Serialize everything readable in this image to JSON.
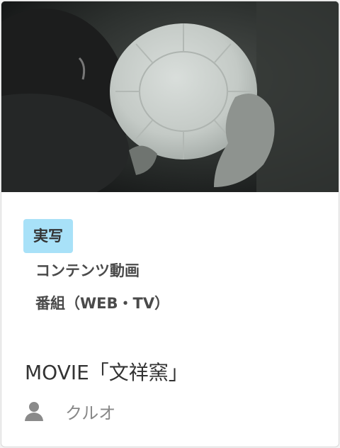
{
  "card": {
    "image_alt": "movie-thumbnail",
    "tag": "実写",
    "categories": [
      "コンテンツ動画",
      "番組（WEB・TV）"
    ],
    "title": "MOVIE「文祥窯」",
    "author": {
      "icon": "person-icon",
      "name": "クルオ"
    }
  },
  "colors": {
    "tag_background": "#a8e1f8",
    "title_text": "#333333",
    "author_text": "#888888"
  }
}
